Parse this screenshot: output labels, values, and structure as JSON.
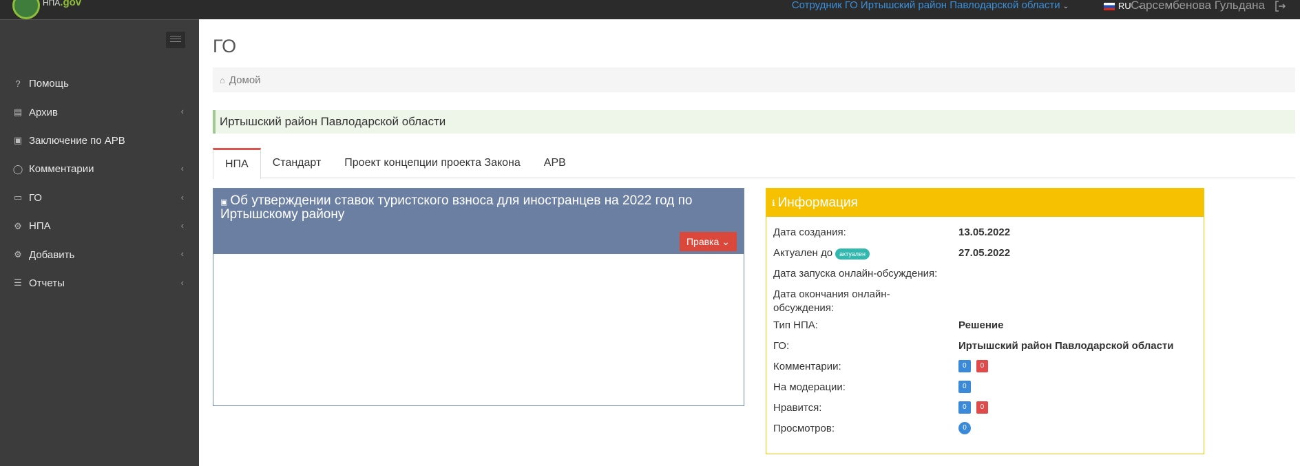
{
  "topbar": {
    "logo_line1": "НПА",
    "logo_line2": ".gov",
    "user_role": "Сотрудник ГО Иртышский район Павлодарской области",
    "language": "RU",
    "username": "Сарсембенова Гульдана"
  },
  "sidebar": {
    "items": [
      {
        "label": "Помощь",
        "icon": "question-icon",
        "has_arrow": false
      },
      {
        "label": "Архив",
        "icon": "archive-icon",
        "has_arrow": true
      },
      {
        "label": "Заключение по АРВ",
        "icon": "clipboard-icon",
        "has_arrow": false
      },
      {
        "label": "Комментарии",
        "icon": "comment-icon",
        "has_arrow": true
      },
      {
        "label": "ГО",
        "icon": "briefcase-icon",
        "has_arrow": true
      },
      {
        "label": "НПА",
        "icon": "gear-icon",
        "has_arrow": true
      },
      {
        "label": "Добавить",
        "icon": "gear-icon",
        "has_arrow": true
      },
      {
        "label": "Отчеты",
        "icon": "list-icon",
        "has_arrow": true
      }
    ]
  },
  "main": {
    "page_title": "ГО",
    "breadcrumb_home": "Домой",
    "org_name": "Иртышский район Павлодарской области",
    "tabs": [
      "НПА",
      "Стандарт",
      "Проект концепции проекта Закона",
      "АРВ"
    ],
    "active_tab": "НПА"
  },
  "npa": {
    "title": "Об утверждении ставок туристского взноса для иностранцев на 2022 год по Иртышскому району",
    "edit_label": "Правка"
  },
  "info": {
    "header": "Информация",
    "created_label": "Дата создания:",
    "created_value": "13.05.2022",
    "actual_label": "Актуален до",
    "actual_badge": "актуален",
    "actual_value": "27.05.2022",
    "discussion_start_label": "Дата запуска онлайн-обсуждения:",
    "discussion_end_label": "Дата окончания онлайн-обсуждения:",
    "type_label": "Тип НПА:",
    "type_value": "Решение",
    "go_label": "ГО:",
    "go_value": "Иртышский район Павлодарской области",
    "comments_label": "Комментарии:",
    "comments_blue": "0",
    "comments_red": "0",
    "moderation_label": "На модерации:",
    "moderation_value": "0",
    "likes_label": "Нравится:",
    "likes_blue": "0",
    "likes_red": "0",
    "views_label": "Просмотров:",
    "views_value": "0"
  },
  "colors": {
    "topbar_bg": "#2b2b2b",
    "sidebar_bg": "#3c3c3c",
    "npa_header_bg": "#6b7fa3",
    "info_header_bg": "#f5c100",
    "active_tab_border": "#d9534f",
    "edit_button_bg": "#d9483b"
  }
}
